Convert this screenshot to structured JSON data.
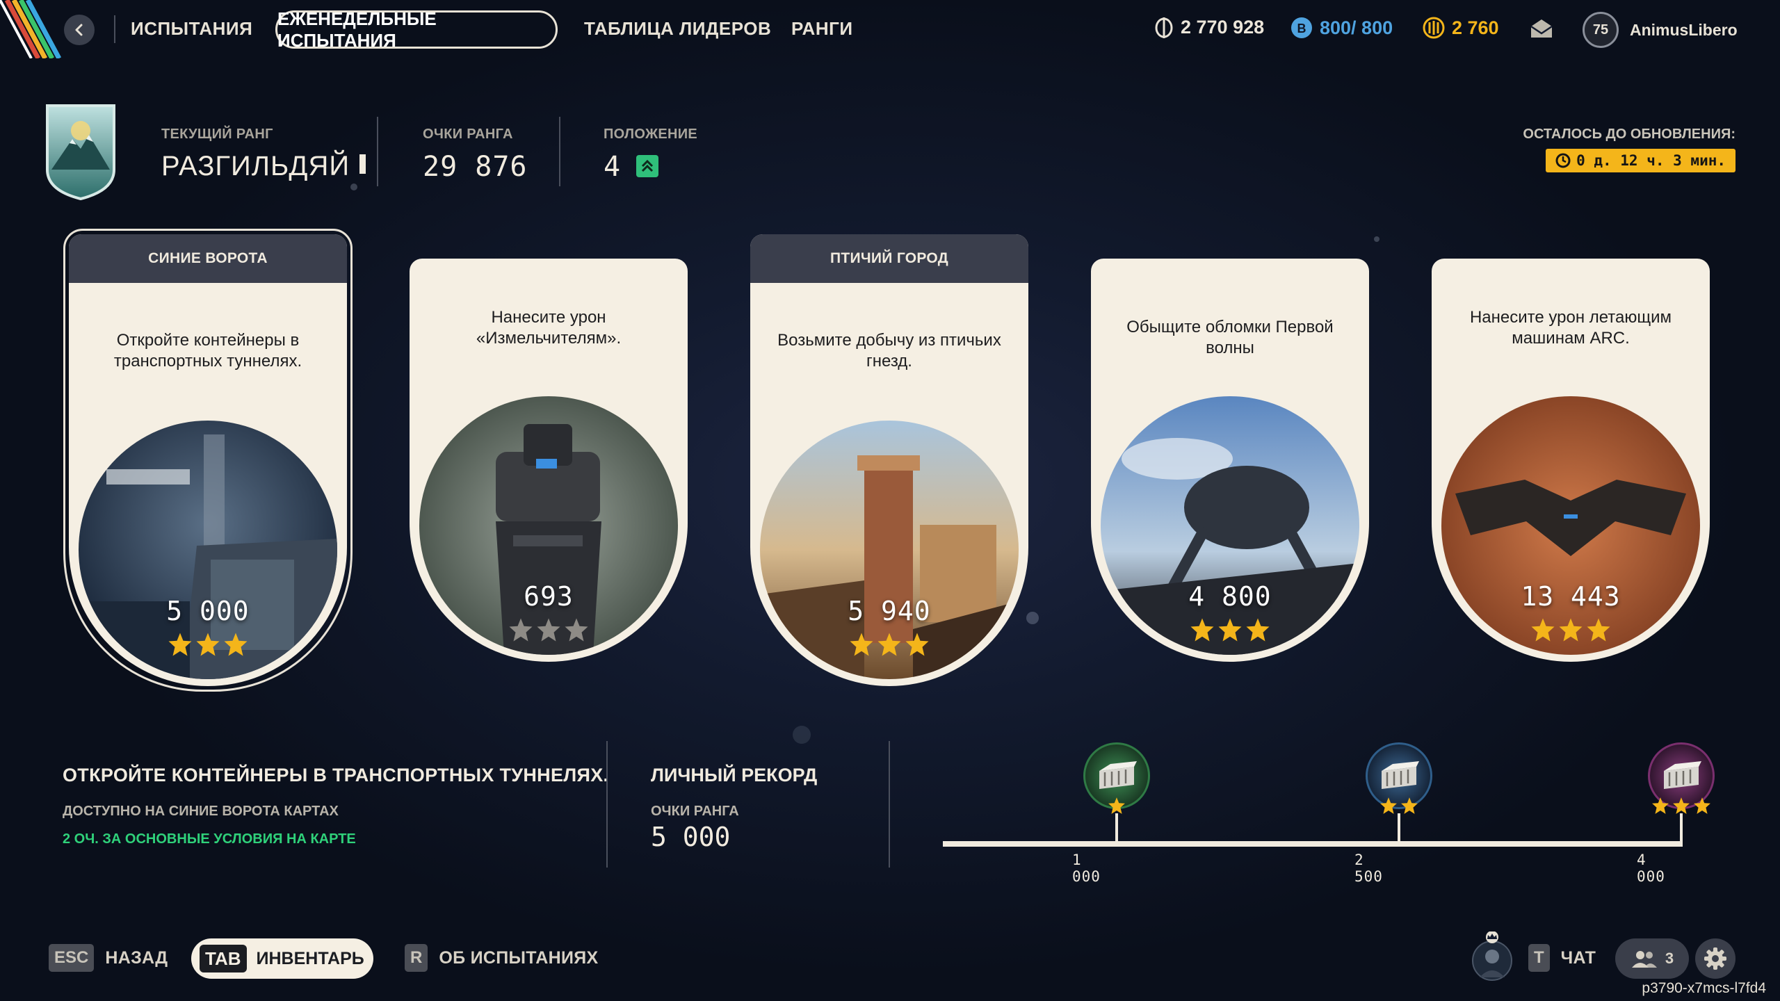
{
  "nav": {
    "title": "ИСПЫТАНИЯ",
    "tabs": [
      {
        "label": "ЕЖЕНЕДЕЛЬНЫЕ ИСПЫТАНИЯ",
        "active": true
      },
      {
        "label": "ТАБЛИЦА ЛИДЕРОВ",
        "active": false
      },
      {
        "label": "РАНГИ",
        "active": false
      }
    ]
  },
  "currencies": {
    "coins": "2 770 928",
    "capacity": "800/ 800",
    "tokens": "2 760",
    "capacity_color": "#4fa3e0",
    "tokens_color": "#f4b51a"
  },
  "user": {
    "level": "75",
    "name": "AnimusLibero"
  },
  "rank": {
    "current_label": "ТЕКУЩИЙ РАНГ",
    "current_value": "РАЗГИЛЬДЯЙ",
    "points_label": "ОЧКИ РАНГА",
    "points_value": "29 876",
    "position_label": "ПОЛОЖЕНИЕ",
    "position_value": "4"
  },
  "timer": {
    "label": "ОСТАЛОСЬ ДО ОБНОВЛЕНИЯ:",
    "value": "0 д. 12 ч. 3 мин."
  },
  "cards": [
    {
      "header": "СИНИЕ ВОРОТА",
      "text": "Откройте контейнеры в транспортных туннелях.",
      "points": "5 000",
      "stars": 3,
      "selected": true
    },
    {
      "header": "",
      "text": "Нанесите урон «Измельчителям».",
      "points": "693",
      "stars": 0,
      "selected": false
    },
    {
      "header": "ПТИЧИЙ ГОРОД",
      "text": "Возьмите добычу из птичьих гнезд.",
      "points": "5 940",
      "stars": 3,
      "selected": false
    },
    {
      "header": "",
      "text": "Обыщите обломки Первой волны",
      "points": "4 800",
      "stars": 3,
      "selected": false
    },
    {
      "header": "",
      "text": "Нанесите урон летающим машинам ARC.",
      "points": "13 443",
      "stars": 3,
      "selected": false
    }
  ],
  "detail": {
    "title": "ОТКРОЙТЕ КОНТЕЙНЕРЫ В ТРАНСПОРТНЫХ ТУННЕЛЯХ.",
    "availability": "ДОСТУПНО НА СИНИЕ ВОРОТА КАРТАХ",
    "bonus": "2 ОЧ. ЗА ОСНОВНЫЕ УСЛОВИЯ НА КАРТЕ"
  },
  "record": {
    "title": "ЛИЧНЫЙ РЕКОРД",
    "label": "ОЧКИ РАНГА",
    "value": "5 000"
  },
  "milestones": [
    {
      "threshold": "1 000",
      "stars": 1,
      "ring_color": "#2f7a45"
    },
    {
      "threshold": "2 500",
      "stars": 2,
      "ring_color": "#2f5e8a"
    },
    {
      "threshold": "4 000",
      "stars": 3,
      "ring_color": "#7a2f6e"
    }
  ],
  "footer": {
    "esc_key": "ESC",
    "back_label": "НАЗАД",
    "tab_key": "TAB",
    "inventory_label": "ИНВЕНТАРЬ",
    "r_key": "R",
    "about_label": "ОБ ИСПЫТАНИЯХ",
    "t_key": "T",
    "chat_label": "ЧАТ",
    "friends_count": "3"
  },
  "watermark": "p3790-x7mcs-l7fd4",
  "star_color": "#f4b51a"
}
